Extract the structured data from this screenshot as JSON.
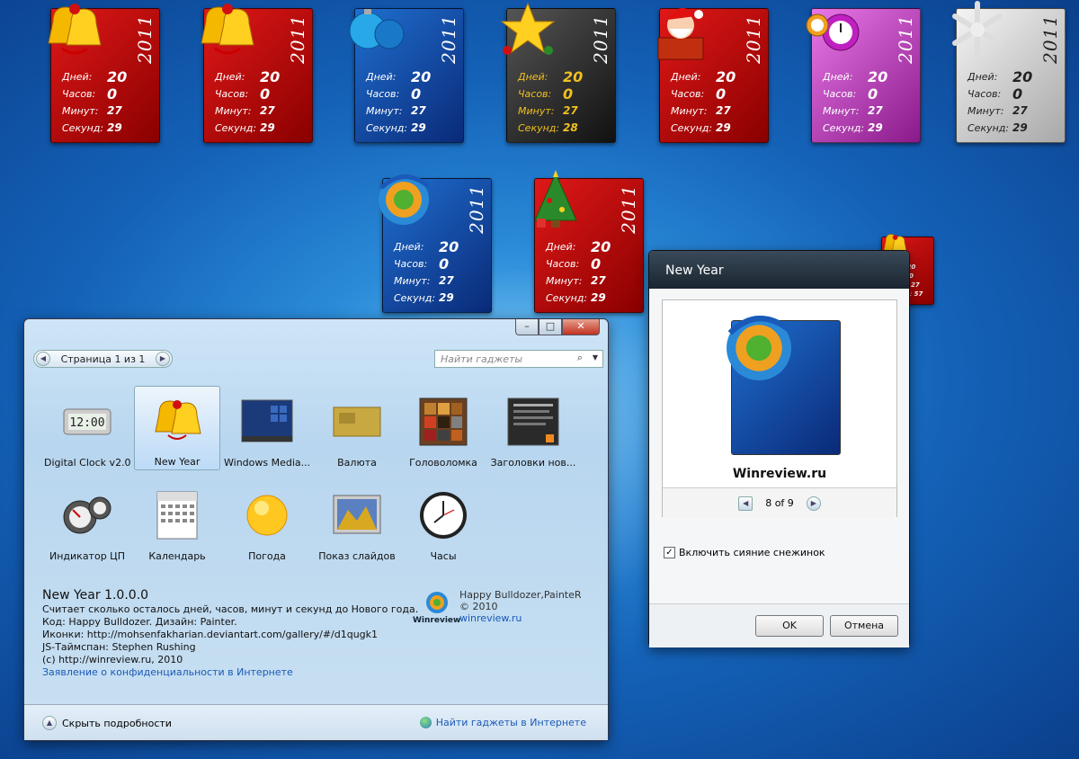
{
  "labels": {
    "days": "Дней:",
    "hours": "Часов:",
    "minutes": "Минут:",
    "seconds": "Секунд:"
  },
  "gadgets": [
    {
      "year": "2011",
      "days": "20",
      "hours": "0",
      "minutes": "27",
      "seconds": "29",
      "theme": "red",
      "icon": "bells-icon"
    },
    {
      "year": "2011",
      "days": "20",
      "hours": "0",
      "minutes": "27",
      "seconds": "29",
      "theme": "red",
      "icon": "bells-icon"
    },
    {
      "year": "2011",
      "days": "20",
      "hours": "0",
      "minutes": "27",
      "seconds": "29",
      "theme": "blue",
      "icon": "ornaments-icon"
    },
    {
      "year": "2011",
      "days": "20",
      "hours": "0",
      "minutes": "27",
      "seconds": "28",
      "theme": "dark",
      "icon": "star-icon"
    },
    {
      "year": "2011",
      "days": "20",
      "hours": "0",
      "minutes": "27",
      "seconds": "29",
      "theme": "red",
      "icon": "santa-icon"
    },
    {
      "year": "2011",
      "days": "20",
      "hours": "0",
      "minutes": "27",
      "seconds": "29",
      "theme": "pink",
      "icon": "alarm-clock-icon"
    },
    {
      "year": "2011",
      "days": "20",
      "hours": "0",
      "minutes": "27",
      "seconds": "29",
      "theme": "silver",
      "icon": "snowflake-icon"
    },
    {
      "year": "2011",
      "days": "20",
      "hours": "0",
      "minutes": "27",
      "seconds": "29",
      "theme": "blue",
      "icon": "winreview-logo-icon"
    },
    {
      "year": "2011",
      "days": "20",
      "hours": "0",
      "minutes": "27",
      "seconds": "29",
      "theme": "red",
      "icon": "tree-icon"
    }
  ],
  "mini": {
    "days": "20",
    "hours": "0",
    "minutes": "27",
    "seconds": "57"
  },
  "gallery": {
    "page": "Страница 1 из 1",
    "search_placeholder": "Найти гаджеты",
    "items": [
      {
        "name": "Digital Clock v2.0",
        "icon": "digital-clock-icon"
      },
      {
        "name": "New Year",
        "icon": "bells-icon"
      },
      {
        "name": "Windows Media...",
        "icon": "media-center-icon"
      },
      {
        "name": "Валюта",
        "icon": "currency-icon"
      },
      {
        "name": "Головоломка",
        "icon": "puzzle-icon"
      },
      {
        "name": "Заголовки нов...",
        "icon": "rss-headlines-icon"
      },
      {
        "name": "Индикатор ЦП",
        "icon": "cpu-meter-icon"
      },
      {
        "name": "Календарь",
        "icon": "calendar-icon"
      },
      {
        "name": "Погода",
        "icon": "weather-sun-icon"
      },
      {
        "name": "Показ слайдов",
        "icon": "slideshow-icon"
      },
      {
        "name": "Часы",
        "icon": "analog-clock-icon"
      }
    ],
    "details": {
      "title": "New Year 1.0.0.0",
      "desc": "Считает сколько осталось дней, часов, минут и секунд до Нового года.",
      "code": "Код: Happy Bulldozer. Дизайн: Painter.",
      "icons": "Иконки: http://mohsenfakharian.deviantart.com/gallery/#/d1qugk1",
      "js": "JS-Таймспан: Stephen Rushing",
      "copy": "(c) http://winreview.ru, 2010",
      "privacy": "Заявление о конфиденциальности в Интернете",
      "author": "Happy Bulldozer,PainteR",
      "year": "© 2010",
      "site": "winreview.ru",
      "logo": "Winreview"
    },
    "hide": "Скрыть подробности",
    "online": "Найти гаджеты в Интернете"
  },
  "dialog": {
    "title": "New Year",
    "caption": "Winreview.ru",
    "pager": "8 of 9",
    "checkbox": "Включить сияние снежинок",
    "ok": "OK",
    "cancel": "Отмена"
  }
}
